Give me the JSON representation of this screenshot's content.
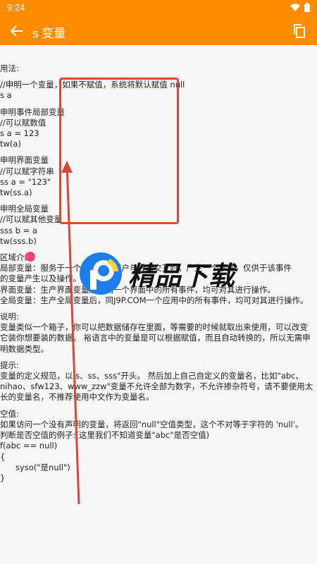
{
  "statusbar": {
    "time": "9:24"
  },
  "appbar": {
    "title": "s 变量",
    "back_icon": "arrow-left-icon",
    "copy_icon": "copy-icon"
  },
  "doc": {
    "lines": [
      "用法:",
      "",
      "//申明一个变量，如果不赋值，系统将默认赋值 null",
      "s a",
      "",
      "申明事件局部变量",
      "//可以赋数值",
      "s a = 123",
      "tw(a)",
      "",
      "申明界面变量",
      "//可以赋字符串",
      "ss a = \"123\"",
      "tw(ss.a)",
      "",
      "申明全局变量",
      "//可以赋其他变量",
      "sss b = a",
      "tw(sss.b)",
      "",
      "区域介绍:",
      "局部变量：服务于一个事件，当用户与界面交互时，产生一个事件，仅供于该事件",
      "的变量产生以及操作。",
      "界面变量：生产界面变量后，同一个界面中的所有事件，均可对其进行操作。",
      "全局变量：生产全局变量后，同J9P.COM一个应用中的所有事件，均可对其进行操作。",
      "",
      "说明:",
      "变量类似一个箱子，你可以把数据储存在里面，等需要的时候就取出来使用，可以改变",
      "它装你想要装的数据。 裕语言中的变量是可以根据赋值，而且自动转换的，所以无需申",
      "明数据类型。",
      "",
      "提示:",
      "变量的定义规范，以 s、ss、sss\"开头。 然后加上自己自定义的变量名，比如\"abc、",
      "nihao、sfw123、www_zzw\"变量不允许全部为数字，不允许掺杂符号，请不要使用太",
      "长的变量名，不推荐使用中文作为变量名。",
      "",
      "空值:",
      "如果访问一个没有声明的变量，将返回\"null\"空值类型，这个不对等于字符的 'null'。",
      "判断是否空值的例子:(这里我们不知道变量\"abc\"是否空值)",
      "f(abc == null)",
      "{",
      "      syso(\"是null\")",
      "}"
    ]
  },
  "watermark": {
    "text": "精品下载",
    "url": "www.j9p.com"
  },
  "colors": {
    "accent": "#ff8c00",
    "annotation": "#d9473b",
    "dot": "#ff3f7f",
    "logo_blue": "#1e7ef0"
  }
}
